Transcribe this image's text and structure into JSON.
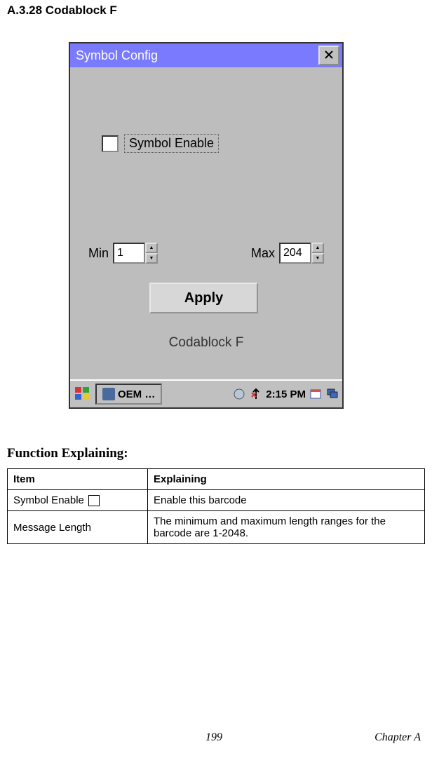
{
  "heading": "A.3.28  Codablock F",
  "dialog": {
    "title": "Symbol Config",
    "symbol_enable_label": "Symbol Enable",
    "min_label": "Min",
    "min_value": "1",
    "max_label": "Max",
    "max_value": "204",
    "apply_label": "Apply",
    "footer_name": "Codablock F"
  },
  "taskbar": {
    "app_label": "OEM …",
    "time": "2:15 PM"
  },
  "function_heading": "Function Explaining:",
  "table": {
    "headers": {
      "item": "Item",
      "explaining": "Explaining"
    },
    "rows": [
      {
        "item": "Symbol Enable",
        "explaining": "Enable this barcode",
        "has_checkbox": true
      },
      {
        "item": "Message Length",
        "explaining": "The minimum and maximum length ranges for the barcode are 1-2048."
      }
    ]
  },
  "footer": {
    "page": "199",
    "chapter": "Chapter A"
  }
}
